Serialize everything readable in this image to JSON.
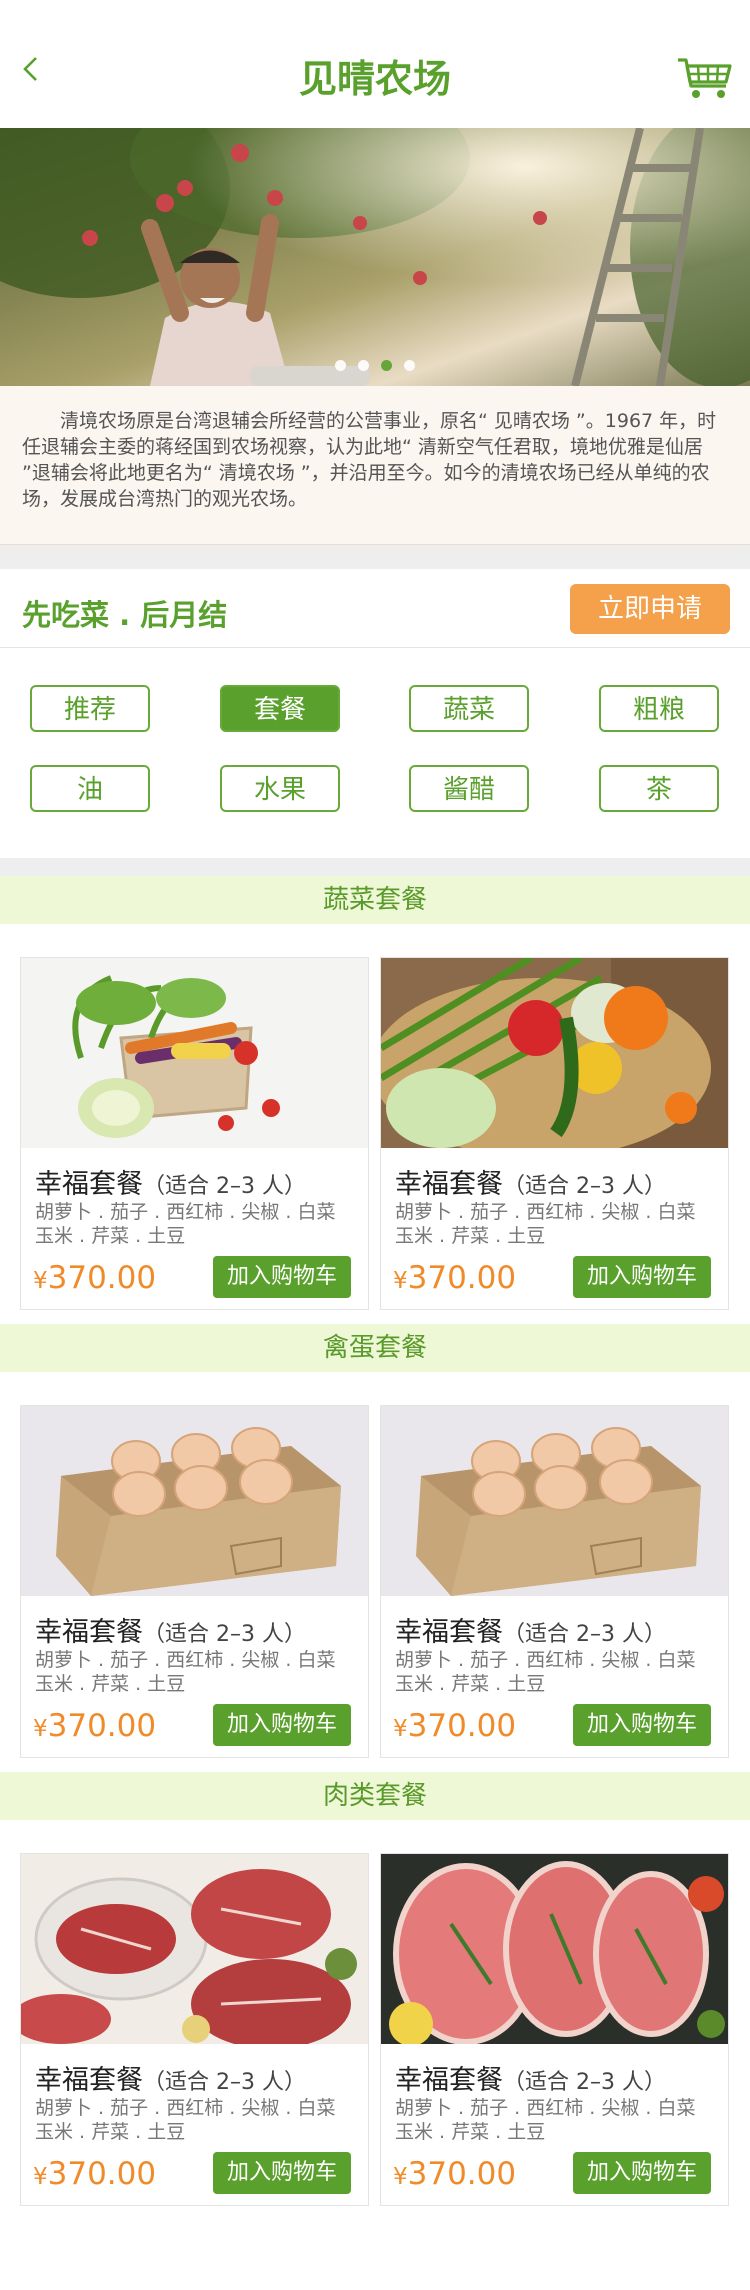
{
  "header": {
    "title": "见晴农场"
  },
  "intro": {
    "text": "清境农场原是台湾退辅会所经营的公营事业，原名“ 见晴农场 ”。1967 年，时任退辅会主委的蒋经国到农场视察，认为此地“ 清新空气任君取，境地优雅是仙居 ”退辅会将此地更名为“ 清境农场 ”，并沿用至今。如今的清境农场已经从单纯的农场，发展成台湾热门的观光农场。"
  },
  "banner": {
    "slides": 4,
    "active_index": 2
  },
  "promo": {
    "slogan": "先吃菜 . 后月结",
    "apply_label": "立即申请"
  },
  "categories": [
    {
      "label": "推荐",
      "active": false
    },
    {
      "label": "套餐",
      "active": true
    },
    {
      "label": "蔬菜",
      "active": false
    },
    {
      "label": "粗粮",
      "active": false
    },
    {
      "label": "油",
      "active": false
    },
    {
      "label": "水果",
      "active": false
    },
    {
      "label": "酱醋",
      "active": false
    },
    {
      "label": "茶",
      "active": false
    }
  ],
  "sections": [
    {
      "title": "蔬菜套餐",
      "products": [
        {
          "name": "幸福套餐",
          "sub": "（适合 2–3 人）",
          "desc_line1": "胡萝卜 . 茄子 . 西红柿 . 尖椒 . 白菜",
          "desc_line2": "玉米 . 芹菜 . 土豆",
          "currency": "¥",
          "price": "370.00",
          "button": "加入购物车"
        },
        {
          "name": "幸福套餐",
          "sub": "（适合 2–3 人）",
          "desc_line1": "胡萝卜 . 茄子 . 西红柿 . 尖椒 . 白菜",
          "desc_line2": "玉米 . 芹菜 . 土豆",
          "currency": "¥",
          "price": "370.00",
          "button": "加入购物车"
        }
      ]
    },
    {
      "title": "禽蛋套餐",
      "products": [
        {
          "name": "幸福套餐",
          "sub": "（适合 2–3 人）",
          "desc_line1": "胡萝卜 . 茄子 . 西红柿 . 尖椒 . 白菜",
          "desc_line2": "玉米 . 芹菜 . 土豆",
          "currency": "¥",
          "price": "370.00",
          "button": "加入购物车"
        },
        {
          "name": "幸福套餐",
          "sub": "（适合 2–3 人）",
          "desc_line1": "胡萝卜 . 茄子 . 西红柿 . 尖椒 . 白菜",
          "desc_line2": "玉米 . 芹菜 . 土豆",
          "currency": "¥",
          "price": "370.00",
          "button": "加入购物车"
        }
      ]
    },
    {
      "title": "肉类套餐",
      "products": [
        {
          "name": "幸福套餐",
          "sub": "（适合 2–3 人）",
          "desc_line1": "胡萝卜 . 茄子 . 西红柿 . 尖椒 . 白菜",
          "desc_line2": "玉米 . 芹菜 . 土豆",
          "currency": "¥",
          "price": "370.00",
          "button": "加入购物车"
        },
        {
          "name": "幸福套餐",
          "sub": "（适合 2–3 人）",
          "desc_line1": "胡萝卜 . 茄子 . 西红柿 . 尖椒 . 白菜",
          "desc_line2": "玉米 . 芹菜 . 土豆",
          "currency": "¥",
          "price": "370.00",
          "button": "加入购物车"
        }
      ]
    }
  ],
  "icons": {
    "back": "chevron-left-icon",
    "cart": "shopping-cart-icon"
  },
  "colors": {
    "brand_green": "#5aa02c",
    "accent_orange": "#f5a04a",
    "price_orange": "#f08b2c",
    "section_bg": "#eef8d6"
  }
}
